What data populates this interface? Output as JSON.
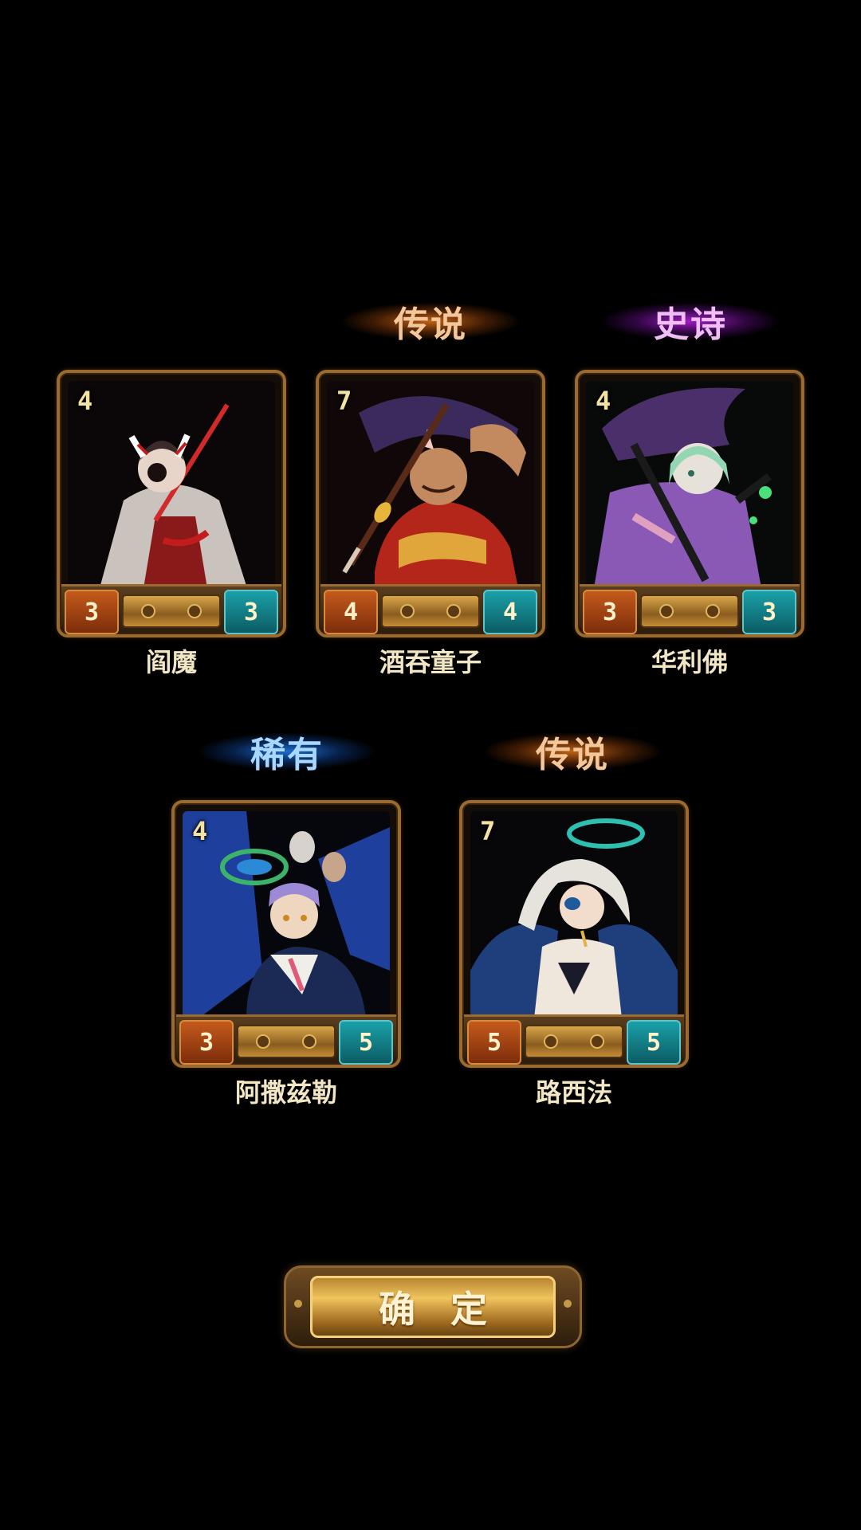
{
  "rarity_labels": {
    "legend_1": "传说",
    "epic": "史诗",
    "rare": "稀有",
    "legend_2": "传说"
  },
  "colors": {
    "legend": "#e27319",
    "epic": "#b41edc",
    "rare": "#1e78e6",
    "frame": "#9a6a2e",
    "attack": "#c45a1c",
    "health": "#1aa0a8"
  },
  "cards": [
    {
      "name": "阎魔",
      "cost": "4",
      "attack": "3",
      "health": "3",
      "rarity": "传说"
    },
    {
      "name": "酒吞童子",
      "cost": "7",
      "attack": "4",
      "health": "4",
      "rarity": "传说"
    },
    {
      "name": "华利佛",
      "cost": "4",
      "attack": "3",
      "health": "3",
      "rarity": "史诗"
    },
    {
      "name": "阿撒兹勒",
      "cost": "4",
      "attack": "3",
      "health": "5",
      "rarity": "稀有"
    },
    {
      "name": "路西法",
      "cost": "7",
      "attack": "5",
      "health": "5",
      "rarity": "传说"
    }
  ],
  "confirm_button": {
    "label": "确定"
  }
}
